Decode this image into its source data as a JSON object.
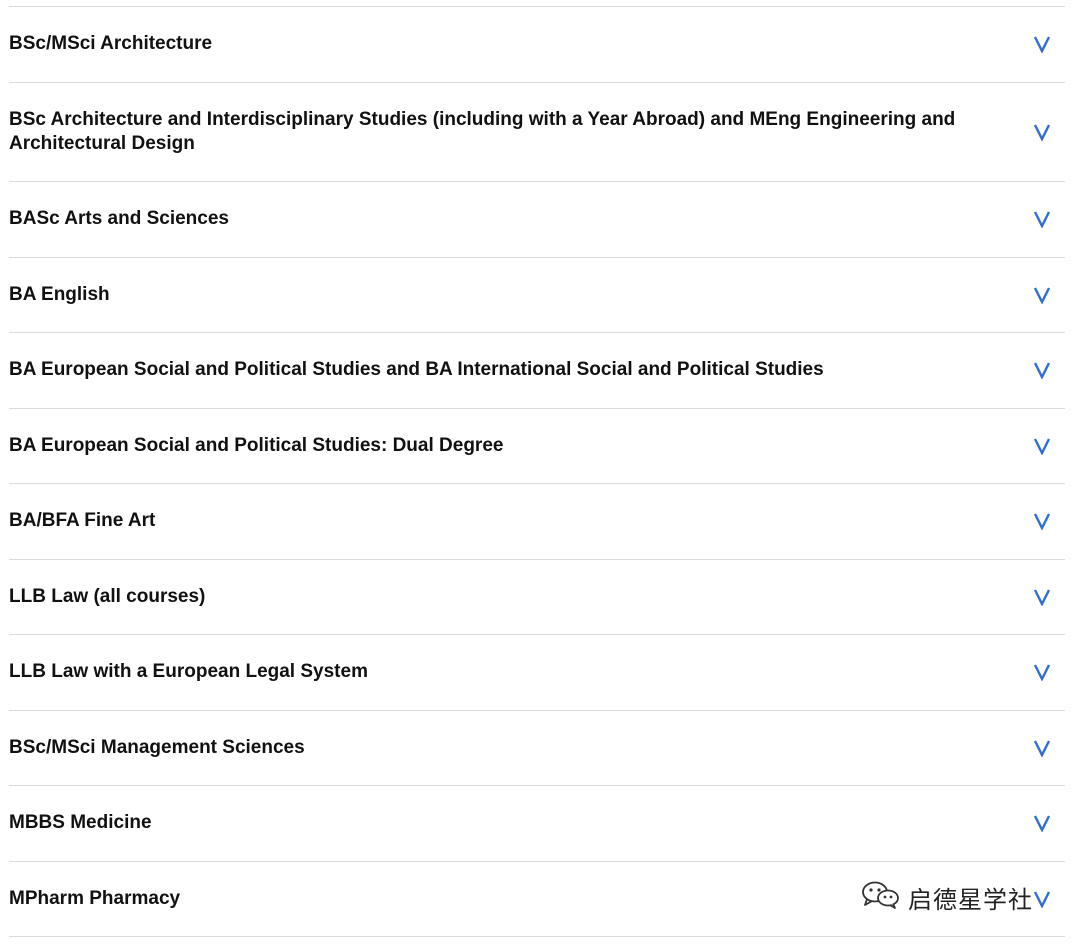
{
  "accordion": {
    "accent_color": "#2f6fd0",
    "chevron_icon": "chevron-down-icon",
    "items": [
      {
        "label": "BSc/MSci Architecture"
      },
      {
        "label": "BSc Architecture and Interdisciplinary Studies (including with a Year Abroad) and MEng Engineering and Architectural Design"
      },
      {
        "label": "BASc Arts and Sciences"
      },
      {
        "label": "BA English"
      },
      {
        "label": "BA European Social and Political Studies and BA International Social and Political Studies"
      },
      {
        "label": "BA European Social and Political Studies: Dual Degree"
      },
      {
        "label": "BA/BFA Fine Art"
      },
      {
        "label": "LLB Law (all courses)"
      },
      {
        "label": "LLB Law with a European Legal System"
      },
      {
        "label": "BSc/MSci Management Sciences"
      },
      {
        "label": "MBBS Medicine"
      },
      {
        "label": "MPharm Pharmacy"
      }
    ]
  },
  "watermark": {
    "text": "启德星学社",
    "icon": "wechat-icon"
  }
}
